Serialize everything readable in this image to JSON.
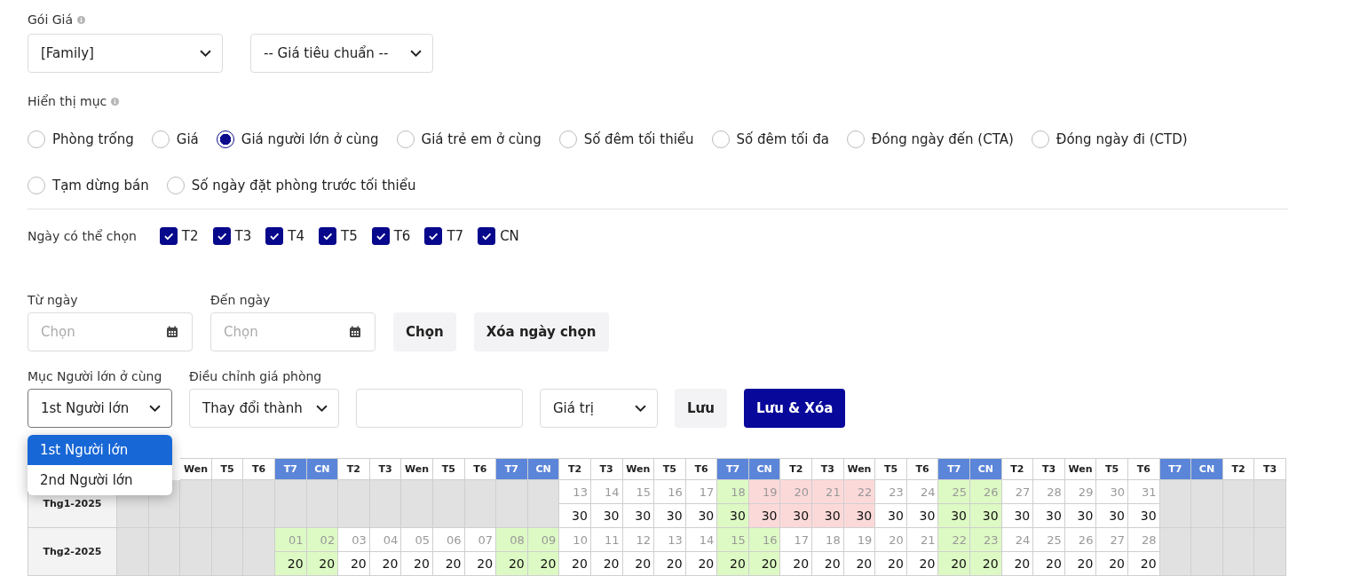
{
  "rate_plan": {
    "label": "Gói Giá",
    "package_select": {
      "value": "[Family]"
    },
    "rate_select": {
      "value": "-- Giá tiêu chuẩn --"
    }
  },
  "display": {
    "label": "Hiển thị mục",
    "options": [
      {
        "label": "Phòng trống",
        "selected": false
      },
      {
        "label": "Giá",
        "selected": false
      },
      {
        "label": "Giá người lớn ở cùng",
        "selected": true
      },
      {
        "label": "Giá trẻ em ở cùng",
        "selected": false
      },
      {
        "label": "Số đêm tối thiểu",
        "selected": false
      },
      {
        "label": "Số đêm tối đa",
        "selected": false
      },
      {
        "label": "Đóng ngày đến (CTA)",
        "selected": false
      },
      {
        "label": "Đóng ngày đi (CTD)",
        "selected": false
      },
      {
        "label": "Tạm dừng bán",
        "selected": false
      },
      {
        "label": "Số ngày đặt phòng trước tối thiểu",
        "selected": false
      }
    ]
  },
  "weekdays": {
    "label": "Ngày có thể chọn",
    "days": [
      {
        "label": "T2",
        "checked": true
      },
      {
        "label": "T3",
        "checked": true
      },
      {
        "label": "T4",
        "checked": true
      },
      {
        "label": "T5",
        "checked": true
      },
      {
        "label": "T6",
        "checked": true
      },
      {
        "label": "T7",
        "checked": true
      },
      {
        "label": "CN",
        "checked": true
      }
    ]
  },
  "date_range": {
    "from": {
      "label": "Từ ngày",
      "placeholder": "Chọn"
    },
    "to": {
      "label": "Đến ngày",
      "placeholder": "Chọn"
    },
    "choose_button": "Chọn",
    "clear_button": "Xóa ngày chọn"
  },
  "adjust": {
    "adult_label": "Mục Người lớn ở cùng",
    "adult_select": {
      "value": "1st Người lớn",
      "options": [
        {
          "label": "1st Người lớn",
          "selected": true
        },
        {
          "label": "2nd Người lớn",
          "selected": false
        }
      ]
    },
    "price_label": "Điều chỉnh giá phòng",
    "mode_select": {
      "value": "Thay đổi thành"
    },
    "unit_select": {
      "value": "Giá trị"
    },
    "save_button": "Lưu",
    "save_clear_button": "Lưu & Xóa"
  },
  "calendar": {
    "header": [
      {
        "label": "Wen",
        "weekend": false
      },
      {
        "label": "T5",
        "weekend": false
      },
      {
        "label": "T6",
        "weekend": false
      },
      {
        "label": "T7",
        "weekend": true
      },
      {
        "label": "CN",
        "weekend": true
      },
      {
        "label": "T2",
        "weekend": false
      },
      {
        "label": "T3",
        "weekend": false
      },
      {
        "label": "Wen",
        "weekend": false
      },
      {
        "label": "T5",
        "weekend": false
      },
      {
        "label": "T6",
        "weekend": false
      },
      {
        "label": "T7",
        "weekend": true
      },
      {
        "label": "CN",
        "weekend": true
      },
      {
        "label": "T2",
        "weekend": false
      },
      {
        "label": "T3",
        "weekend": false
      },
      {
        "label": "Wen",
        "weekend": false
      },
      {
        "label": "T5",
        "weekend": false
      },
      {
        "label": "T6",
        "weekend": false
      },
      {
        "label": "T7",
        "weekend": true
      },
      {
        "label": "CN",
        "weekend": true
      },
      {
        "label": "T2",
        "weekend": false
      },
      {
        "label": "T3",
        "weekend": false
      },
      {
        "label": "Wen",
        "weekend": false
      },
      {
        "label": "T5",
        "weekend": false
      },
      {
        "label": "T6",
        "weekend": false
      },
      {
        "label": "T7",
        "weekend": true
      },
      {
        "label": "CN",
        "weekend": true
      },
      {
        "label": "T2",
        "weekend": false
      },
      {
        "label": "T3",
        "weekend": false
      },
      {
        "label": "Wen",
        "weekend": false
      },
      {
        "label": "T5",
        "weekend": false
      },
      {
        "label": "T6",
        "weekend": false
      },
      {
        "label": "T7",
        "weekend": true
      },
      {
        "label": "CN",
        "weekend": true
      },
      {
        "label": "T2",
        "weekend": false
      },
      {
        "label": "T3",
        "weekend": false
      }
    ],
    "months": [
      {
        "label": "Thg1-2025",
        "cells": [
          {
            "kind": "empty"
          },
          {
            "kind": "empty"
          },
          {
            "kind": "empty"
          },
          {
            "kind": "empty"
          },
          {
            "kind": "empty"
          },
          {
            "kind": "empty"
          },
          {
            "kind": "empty"
          },
          {
            "kind": "empty"
          },
          {
            "kind": "empty"
          },
          {
            "kind": "empty"
          },
          {
            "kind": "empty"
          },
          {
            "kind": "empty"
          },
          {
            "kind": "empty"
          },
          {
            "kind": "empty"
          },
          {
            "kind": "day",
            "day": "13",
            "price": "30",
            "color": "#ffffff"
          },
          {
            "kind": "day",
            "day": "14",
            "price": "30",
            "color": "#ffffff"
          },
          {
            "kind": "day",
            "day": "15",
            "price": "30",
            "color": "#ffffff"
          },
          {
            "kind": "day",
            "day": "16",
            "price": "30",
            "color": "#ffffff"
          },
          {
            "kind": "day",
            "day": "17",
            "price": "30",
            "color": "#ffffff"
          },
          {
            "kind": "day",
            "day": "18",
            "price": "30",
            "color": "#ddf9c4"
          },
          {
            "kind": "day",
            "day": "19",
            "price": "30",
            "color": "#fcd9d9"
          },
          {
            "kind": "day",
            "day": "20",
            "price": "30",
            "color": "#fcd9d9"
          },
          {
            "kind": "day",
            "day": "21",
            "price": "30",
            "color": "#fcd9d9"
          },
          {
            "kind": "day",
            "day": "22",
            "price": "30",
            "color": "#fcd9d9"
          },
          {
            "kind": "day",
            "day": "23",
            "price": "30",
            "color": "#ffffff"
          },
          {
            "kind": "day",
            "day": "24",
            "price": "30",
            "color": "#ffffff"
          },
          {
            "kind": "day",
            "day": "25",
            "price": "30",
            "color": "#ddf9c4"
          },
          {
            "kind": "day",
            "day": "26",
            "price": "30",
            "color": "#ddf9c4"
          },
          {
            "kind": "day",
            "day": "27",
            "price": "30",
            "color": "#ffffff"
          },
          {
            "kind": "day",
            "day": "28",
            "price": "30",
            "color": "#ffffff"
          },
          {
            "kind": "day",
            "day": "29",
            "price": "30",
            "color": "#ffffff"
          },
          {
            "kind": "day",
            "day": "30",
            "price": "30",
            "color": "#ffffff"
          },
          {
            "kind": "day",
            "day": "31",
            "price": "30",
            "color": "#ffffff"
          },
          {
            "kind": "empty"
          },
          {
            "kind": "empty"
          },
          {
            "kind": "empty"
          },
          {
            "kind": "empty"
          }
        ]
      },
      {
        "label": "Thg2-2025",
        "cells": [
          {
            "kind": "empty"
          },
          {
            "kind": "empty"
          },
          {
            "kind": "empty"
          },
          {
            "kind": "empty"
          },
          {
            "kind": "empty"
          },
          {
            "kind": "day",
            "day": "01",
            "price": "20",
            "color": "#ddf9c4"
          },
          {
            "kind": "day",
            "day": "02",
            "price": "20",
            "color": "#ddf9c4"
          },
          {
            "kind": "day",
            "day": "03",
            "price": "20",
            "color": "#ffffff"
          },
          {
            "kind": "day",
            "day": "04",
            "price": "20",
            "color": "#ffffff"
          },
          {
            "kind": "day",
            "day": "05",
            "price": "20",
            "color": "#ffffff"
          },
          {
            "kind": "day",
            "day": "06",
            "price": "20",
            "color": "#ffffff"
          },
          {
            "kind": "day",
            "day": "07",
            "price": "20",
            "color": "#ffffff"
          },
          {
            "kind": "day",
            "day": "08",
            "price": "20",
            "color": "#ddf9c4"
          },
          {
            "kind": "day",
            "day": "09",
            "price": "20",
            "color": "#ddf9c4"
          },
          {
            "kind": "day",
            "day": "10",
            "price": "20",
            "color": "#ffffff"
          },
          {
            "kind": "day",
            "day": "11",
            "price": "20",
            "color": "#ffffff"
          },
          {
            "kind": "day",
            "day": "12",
            "price": "20",
            "color": "#ffffff"
          },
          {
            "kind": "day",
            "day": "13",
            "price": "20",
            "color": "#ffffff"
          },
          {
            "kind": "day",
            "day": "14",
            "price": "20",
            "color": "#ffffff"
          },
          {
            "kind": "day",
            "day": "15",
            "price": "20",
            "color": "#ddf9c4"
          },
          {
            "kind": "day",
            "day": "16",
            "price": "20",
            "color": "#ddf9c4"
          },
          {
            "kind": "day",
            "day": "17",
            "price": "20",
            "color": "#ffffff"
          },
          {
            "kind": "day",
            "day": "18",
            "price": "20",
            "color": "#ffffff"
          },
          {
            "kind": "day",
            "day": "19",
            "price": "20",
            "color": "#ffffff"
          },
          {
            "kind": "day",
            "day": "20",
            "price": "20",
            "color": "#ffffff"
          },
          {
            "kind": "day",
            "day": "21",
            "price": "20",
            "color": "#ffffff"
          },
          {
            "kind": "day",
            "day": "22",
            "price": "20",
            "color": "#ddf9c4"
          },
          {
            "kind": "day",
            "day": "23",
            "price": "20",
            "color": "#ddf9c4"
          },
          {
            "kind": "day",
            "day": "24",
            "price": "20",
            "color": "#ffffff"
          },
          {
            "kind": "day",
            "day": "25",
            "price": "20",
            "color": "#ffffff"
          },
          {
            "kind": "day",
            "day": "26",
            "price": "20",
            "color": "#ffffff"
          },
          {
            "kind": "day",
            "day": "27",
            "price": "20",
            "color": "#ffffff"
          },
          {
            "kind": "day",
            "day": "28",
            "price": "20",
            "color": "#ffffff"
          },
          {
            "kind": "empty"
          },
          {
            "kind": "empty"
          },
          {
            "kind": "empty"
          },
          {
            "kind": "empty"
          }
        ]
      }
    ]
  }
}
